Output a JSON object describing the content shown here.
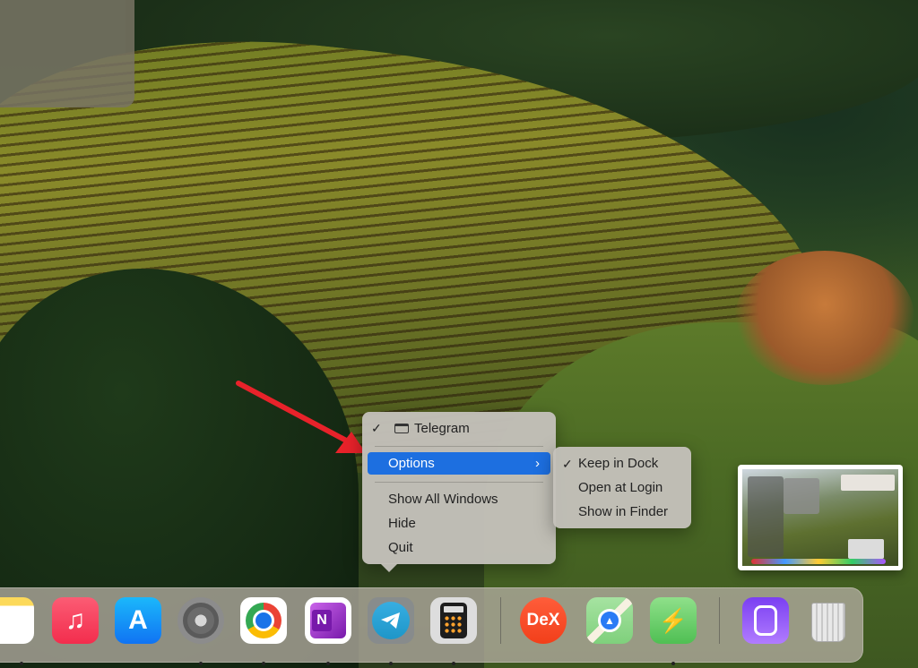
{
  "telegram_menu": {
    "check": "✓",
    "app_name": "Telegram",
    "options_label": "Options",
    "options_chevron": "›",
    "show_all_windows": "Show All Windows",
    "hide": "Hide",
    "quit": "Quit"
  },
  "options_submenu": {
    "items": [
      {
        "label": "Keep in Dock",
        "check": "✓"
      },
      {
        "label": "Open at Login",
        "check": ""
      },
      {
        "label": "Show in Finder",
        "check": ""
      }
    ]
  },
  "dock": {
    "apps": [
      {
        "name": "Notes",
        "icon": "notes-icon",
        "running": true
      },
      {
        "name": "Music",
        "icon": "music-icon",
        "glyph": "♫",
        "running": false
      },
      {
        "name": "App Store",
        "icon": "app-store-icon",
        "glyph": "A",
        "running": false
      },
      {
        "name": "System Settings",
        "icon": "settings-icon",
        "running": true
      },
      {
        "name": "Google Chrome",
        "icon": "chrome-icon",
        "running": true
      },
      {
        "name": "OneNote",
        "icon": "onenote-icon",
        "glyph": "N",
        "running": true
      },
      {
        "name": "Telegram",
        "icon": "telegram-icon",
        "running": true
      },
      {
        "name": "Calculator",
        "icon": "calculator-icon",
        "running": true
      },
      {
        "name": "DeX",
        "icon": "dex-icon",
        "glyph": "DeX",
        "running": false
      },
      {
        "name": "Maps",
        "icon": "maps-icon",
        "running": false
      },
      {
        "name": "Battery",
        "icon": "battery-icon",
        "glyph": "⚡",
        "running": true
      },
      {
        "name": "Remote",
        "icon": "remote-icon",
        "running": false
      },
      {
        "name": "Trash",
        "icon": "trash-icon",
        "running": false
      }
    ]
  },
  "colors": {
    "menu_highlight": "#1d6fe0",
    "arrow": "#e8222a"
  }
}
